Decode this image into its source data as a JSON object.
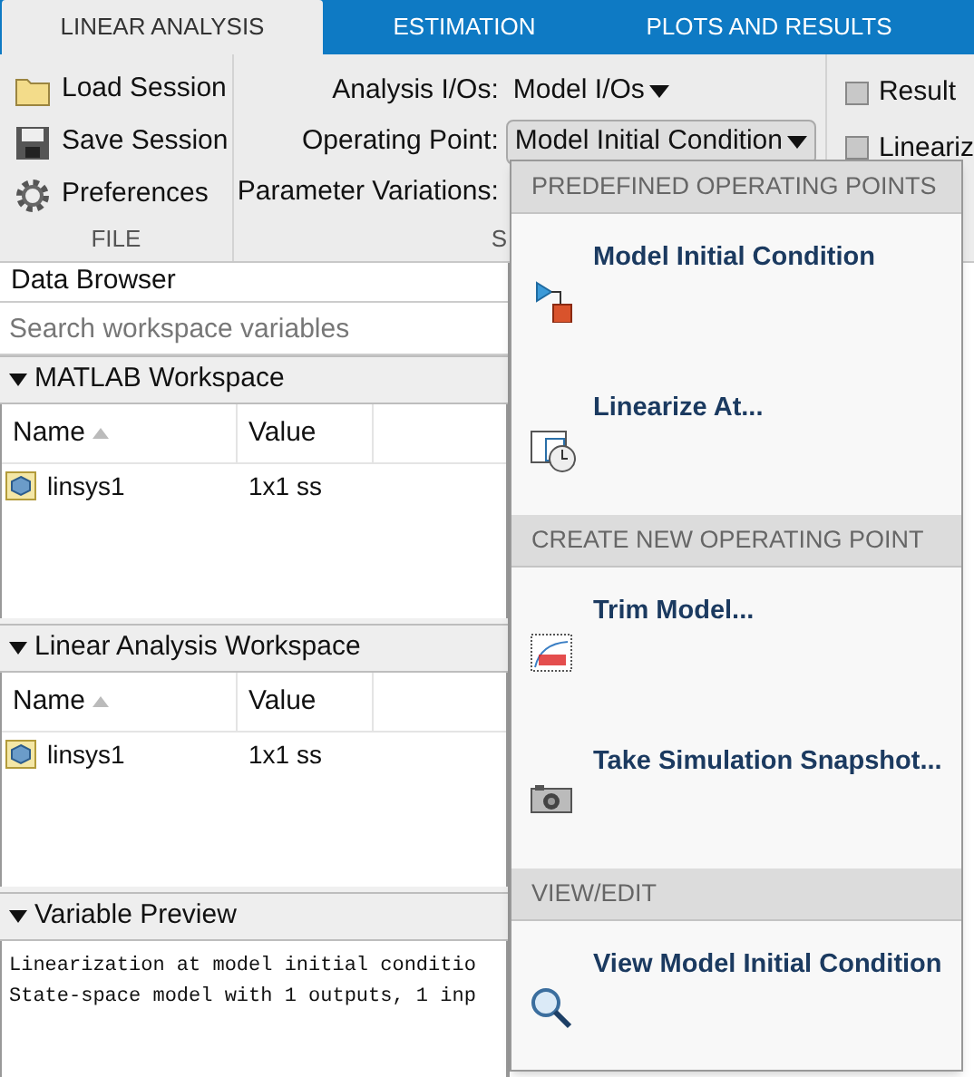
{
  "tabs": [
    {
      "label": "LINEAR ANALYSIS",
      "selected": true
    },
    {
      "label": "ESTIMATION",
      "selected": false
    },
    {
      "label": "PLOTS AND RESULTS",
      "selected": false
    }
  ],
  "ribbon": {
    "file_section": {
      "label": "FILE",
      "buttons": [
        {
          "kind": "folder",
          "label": "Load Session"
        },
        {
          "kind": "disk",
          "label": "Save Session"
        },
        {
          "kind": "gear",
          "label": "Preferences"
        }
      ]
    },
    "setup_section": {
      "label": "S",
      "fields": [
        {
          "label": "Analysis I/Os:",
          "value": "Model I/Os",
          "boxed": false
        },
        {
          "label": "Operating Point:",
          "value": "Model Initial Condition",
          "boxed": true
        },
        {
          "label": "Parameter Variations:"
        }
      ]
    },
    "options": [
      {
        "label": "Result",
        "checked": false
      },
      {
        "label": "Lineariz",
        "checked": false
      }
    ]
  },
  "data_browser": {
    "title": "Data Browser",
    "search": {
      "placeholder": "Search workspace variables"
    },
    "workspaces": [
      {
        "title": "MATLAB Workspace",
        "expanded": true,
        "columns": [
          "Name",
          "Value"
        ],
        "rows": [
          {
            "name": "linsys1",
            "value": "1x1 ss"
          }
        ]
      },
      {
        "title": "Linear Analysis Workspace",
        "expanded": true,
        "columns": [
          "Name",
          "Value"
        ],
        "rows": [
          {
            "name": "linsys1",
            "value": "1x1 ss"
          }
        ]
      }
    ],
    "preview": {
      "title": "Variable Preview",
      "expanded": true,
      "lines": [
        "Linearization at model initial conditio",
        "State-space model with 1 outputs, 1 inp"
      ]
    }
  },
  "dropdown": {
    "sections": [
      {
        "header": "PREDEFINED OPERATING POINTS",
        "items": [
          {
            "kind": "model",
            "label": "Model Initial Condition"
          },
          {
            "kind": "clock",
            "label": "Linearize At..."
          }
        ]
      },
      {
        "header": "CREATE NEW OPERATING POINT",
        "items": [
          {
            "kind": "trim",
            "label": "Trim Model..."
          },
          {
            "kind": "camera",
            "label": "Take Simulation Snapshot..."
          }
        ]
      },
      {
        "header": "VIEW/EDIT",
        "items": [
          {
            "kind": "magnifier",
            "label": "View Model Initial Condition"
          }
        ]
      }
    ]
  }
}
